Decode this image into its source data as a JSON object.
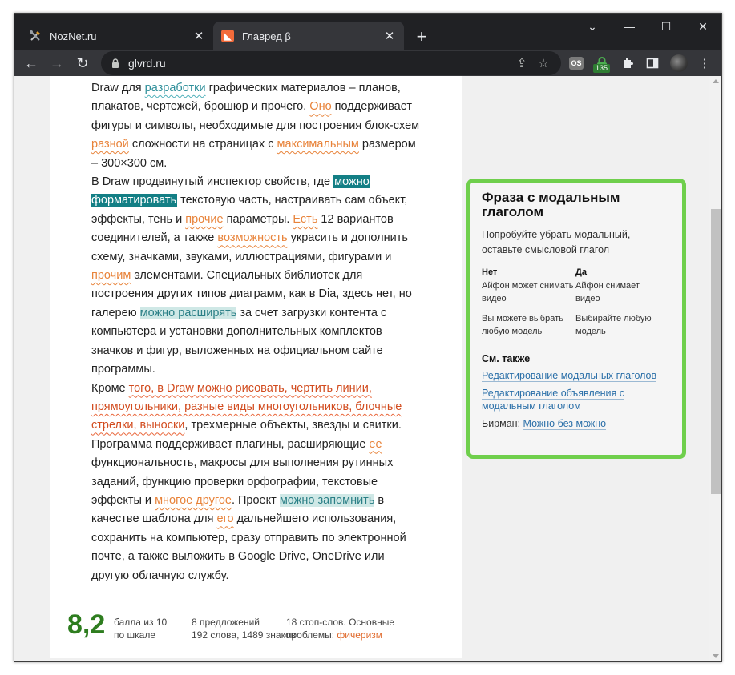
{
  "browser": {
    "tabs": [
      {
        "title": "NozNet.ru",
        "icon": "tools-icon",
        "active": false
      },
      {
        "title": "Главред β",
        "icon": "glvrd-icon",
        "active": true
      }
    ],
    "url": "glvrd.ru",
    "extension_badge": "135",
    "extension_os_label": "OS"
  },
  "article": {
    "paragraphs": [
      [
        {
          "t": "Draw для "
        },
        {
          "t": "разработки",
          "c": "b"
        },
        {
          "t": " графических материалов – планов, плакатов, чертежей, брошюр и прочего. "
        },
        {
          "t": "Оно",
          "c": "u"
        },
        {
          "t": " поддерживает фигуры и символы, необходимые для построения блок-схем "
        },
        {
          "t": "разной",
          "c": "u"
        },
        {
          "t": " сложности на страницах с "
        },
        {
          "t": "максимальным",
          "c": "u"
        },
        {
          "t": " размером – 300×300 см."
        }
      ],
      [
        {
          "t": "В Draw продвинутый инспектор свойств, где "
        },
        {
          "t": "можно форматировать",
          "c": "sel"
        },
        {
          "t": " текстовую часть, настраивать сам объект, эффекты, тень и "
        },
        {
          "t": "прочие",
          "c": "u"
        },
        {
          "t": " параметры. "
        },
        {
          "t": "Есть",
          "c": "u"
        },
        {
          "t": " 12 вариантов соединителей, а также "
        },
        {
          "t": "возможность",
          "c": "u"
        },
        {
          "t": " украсить и дополнить схему, значками, звуками, иллюстрациями, фигурами и "
        },
        {
          "t": "прочим",
          "c": "u"
        },
        {
          "t": " элементами. Специальных библиотек для построения других типов диаграмм, как в Dia, здесь нет, но галерею "
        },
        {
          "t": "можно расширять",
          "c": "hl"
        },
        {
          "t": " за счет загрузки контента с компьютера и установки дополнительных комплектов значков и фигур, выложенных на официальном сайте программы."
        }
      ],
      [
        {
          "t": "Кроме "
        },
        {
          "t": "того, в Draw можно рисовать, чертить линии, прямоугольники, разные виды многоугольников, блочные стрелки, выноски",
          "c": "w"
        },
        {
          "t": ", трехмерные объекты, звезды и свитки. Программа поддерживает плагины, расширяющие "
        },
        {
          "t": "ее",
          "c": "u"
        },
        {
          "t": " функциональность, макросы для выполнения рутинных заданий, функцию проверки орфографии, текстовые эффекты и "
        },
        {
          "t": "многое другое",
          "c": "u"
        },
        {
          "t": ". Проект "
        },
        {
          "t": "можно запомнить",
          "c": "hl"
        },
        {
          "t": " в качестве шаблона для "
        },
        {
          "t": "его",
          "c": "u"
        },
        {
          "t": " дальнейшего использования, сохранить на компьютер, сразу отправить по электронной почте, а также выложить в Google Drive, OneDrive или другую облачную службу."
        }
      ]
    ]
  },
  "stats": {
    "score": "8,2",
    "score_caption_1": "балла из 10",
    "score_caption_2": "по шкале",
    "sentences": "8 предложений",
    "words": "192 слова, 1489 знаков",
    "stopwords": "18 стоп-слов. Основные",
    "problems_label": "проблемы:",
    "problems_link": "фичеризм"
  },
  "tooltip": {
    "title": "Фраза с модальным глаголом",
    "description": "Попробуйте убрать модальный, оставьте смысловой глагол",
    "no_header": "Нет",
    "yes_header": "Да",
    "examples": [
      {
        "no": "Айфон может снимать видео",
        "yes": "Айфон снимает видео"
      },
      {
        "no": "Вы можете выбрать любую модель",
        "yes": "Выбирайте любую модель"
      }
    ],
    "see_also": "См. также",
    "links": [
      "Редактирование модальных глаголов",
      "Редактирование объявления с модальным глаголом"
    ],
    "author_label": "Бирман:",
    "author_link": "Можно без можно"
  },
  "colors": {
    "card_border": "#6fcf4c",
    "score": "#2e7d1f",
    "selection": "#137f85",
    "warning": "#e8833a"
  }
}
